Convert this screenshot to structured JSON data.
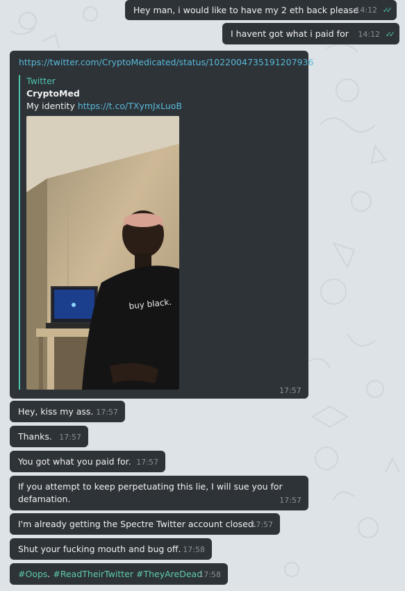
{
  "outgoing": [
    {
      "text": "Hey man, i would like to have my 2 eth back please",
      "time": "14:12",
      "status": "read"
    },
    {
      "text": "I havent got what i paid for",
      "time": "14:12",
      "status": "read"
    }
  ],
  "link_message": {
    "url": "https://twitter.com/CryptoMedicated/status/1022004735191207936",
    "preview_site": "Twitter",
    "preview_title": "CryptoMed",
    "preview_text": "My identity",
    "preview_link": "https://t.co/TXymJxLuoB",
    "photo_shirt_text": "buy black.",
    "time": "17:57"
  },
  "incoming": [
    {
      "text": "Hey, kiss my ass.",
      "time": "17:57"
    },
    {
      "text": "Thanks.",
      "time": "17:57"
    },
    {
      "text": "You got what you paid for.",
      "time": "17:57"
    },
    {
      "text": "If you attempt to keep perpetuating this lie, I will sue you for",
      "text2": "defamation.",
      "time": "17:57"
    },
    {
      "text": "I'm already getting the Spectre Twitter account closed.",
      "time": "17:57"
    },
    {
      "text": "Shut your fucking mouth and bug off.",
      "time": "17:58"
    }
  ],
  "hashtag_message": {
    "tags": [
      "#Oops",
      ". ",
      "#ReadTheirTwitter",
      " ",
      "#TheyAreDead"
    ],
    "time": "17:58"
  },
  "colors": {
    "bubble": "#2e3338",
    "background": "#dde3e6",
    "link": "#58b9d9",
    "hashtag": "#5ecbb0",
    "read_ticks": "#4fc3ad"
  }
}
